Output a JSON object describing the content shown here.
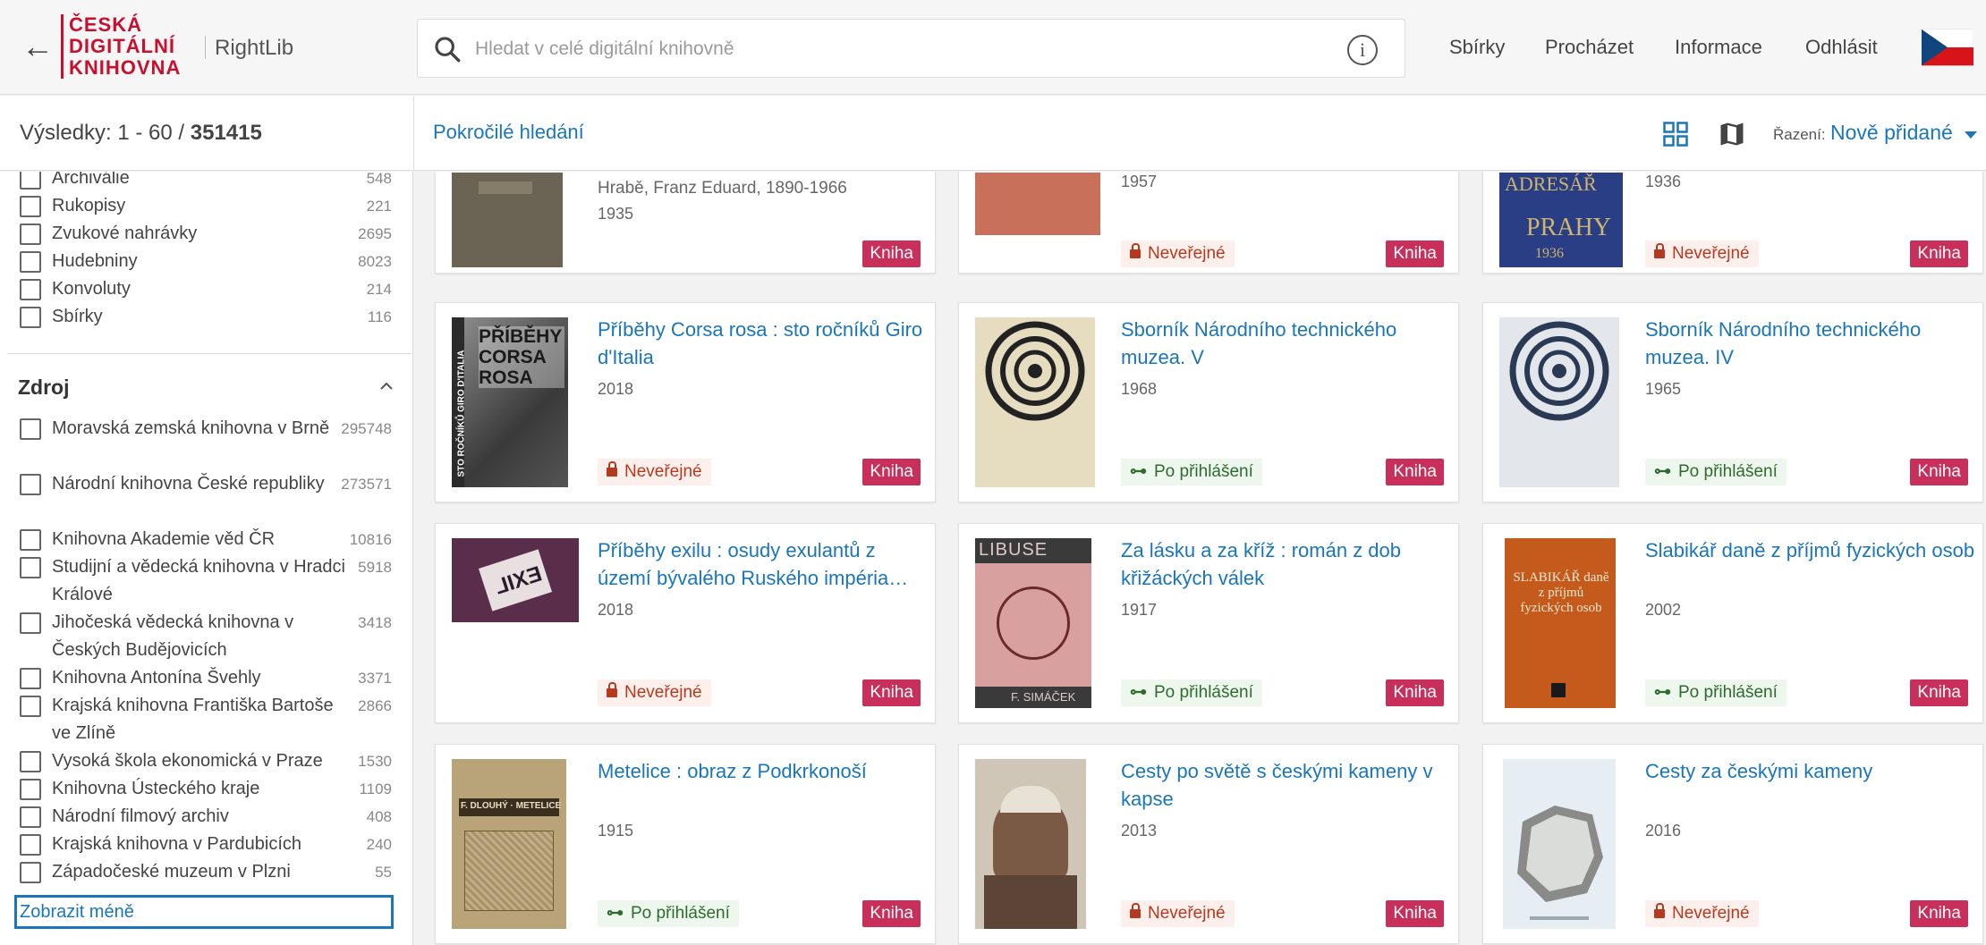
{
  "header": {
    "back_label": "←",
    "logo_line1": "ČESKÁ",
    "logo_line2": "DIGITÁLNÍ",
    "logo_line3": "KNIHOVNA",
    "app_name": "RightLib",
    "search_placeholder": "Hledat v celé digitální knihovně",
    "info_label": "i",
    "nav": [
      "Sbírky",
      "Procházet",
      "Informace",
      "Odhlásit"
    ]
  },
  "results": {
    "prefix": "Výsledky: 1 - 60 / ",
    "total": "351415",
    "advanced_search": "Pokročilé hledání",
    "sort_label": "Řazení:",
    "sort_value": "Nově přidané"
  },
  "sidebar": {
    "type_items": [
      {
        "label": "Archiválie",
        "count": "548"
      },
      {
        "label": "Rukopisy",
        "count": "221"
      },
      {
        "label": "Zvukové nahrávky",
        "count": "2695"
      },
      {
        "label": "Hudebniny",
        "count": "8023"
      },
      {
        "label": "Konvoluty",
        "count": "214"
      },
      {
        "label": "Sbírky",
        "count": "116"
      }
    ],
    "source_title": "Zdroj",
    "source_items": [
      {
        "label": "Moravská zemská knihovna v Brně",
        "count": "295748"
      },
      {
        "label": "Národní knihovna České republiky",
        "count": "273571"
      },
      {
        "label": "Knihovna Akademie věd ČR",
        "count": "10816"
      },
      {
        "label": "Studijní a vědecká knihovna v Hradci Králové",
        "count": "5918"
      },
      {
        "label": "Jihočeská vědecká knihovna v Českých Budějovicích",
        "count": "3418"
      },
      {
        "label": "Knihovna Antonína Švehly",
        "count": "3371"
      },
      {
        "label": "Krajská knihovna Františka Bartoše ve Zlíně",
        "count": "2866"
      },
      {
        "label": "Vysoká škola ekonomická v Praze",
        "count": "1530"
      },
      {
        "label": "Knihovna Ústeckého kraje",
        "count": "1109"
      },
      {
        "label": "Národní filmový archiv",
        "count": "408"
      },
      {
        "label": "Krajská knihovna v Pardubicích",
        "count": "240"
      },
      {
        "label": "Západočeské muzeum v Plzni",
        "count": "55"
      }
    ],
    "show_less": "Zobrazit méně"
  },
  "cards": [
    {
      "title": "Hrabě, Franz Eduard, 1890-1966",
      "year": "1935",
      "access": "",
      "type": "Kniha"
    },
    {
      "title": "",
      "year": "1957",
      "access": "Neveřejné",
      "type": "Kniha"
    },
    {
      "title": "",
      "year": "1936",
      "access": "Neveřejné",
      "type": "Kniha"
    },
    {
      "title": "Příběhy Corsa rosa : sto ročníků Giro d'Italia",
      "year": "2018",
      "access": "Neveřejné",
      "type": "Kniha"
    },
    {
      "title": "Sborník Národního technického muzea. V",
      "year": "1968",
      "access": "Po přihlášení",
      "type": "Kniha"
    },
    {
      "title": "Sborník Národního technického muzea. IV",
      "year": "1965",
      "access": "Po přihlášení",
      "type": "Kniha"
    },
    {
      "title": "Příběhy exilu : osudy exulantů z území bývalého Ruského impéria…",
      "year": "2018",
      "access": "Neveřejné",
      "type": "Kniha"
    },
    {
      "title": "Za lásku a za kříž : román z dob křižáckých válek",
      "year": "1917",
      "access": "Po přihlášení",
      "type": "Kniha"
    },
    {
      "title": "Slabikář daně z příjmů fyzických osob",
      "year": "2002",
      "access": "Po přihlášení",
      "type": "Kniha"
    },
    {
      "title": "Metelice : obraz z Podkrkonoší",
      "year": "1915",
      "access": "Po přihlášení",
      "type": "Kniha"
    },
    {
      "title": "Cesty po světě s českými kameny v kapse",
      "year": "2013",
      "access": "Neveřejné",
      "type": "Kniha"
    },
    {
      "title": "Cesty za českými kameny",
      "year": "2016",
      "access": "Neveřejné",
      "type": "Kniha"
    }
  ],
  "cover_texts": {
    "corsa": "PŘÍBĚHY CORSA ROSA",
    "corsa_side": "STO ROČNÍKŮ GIRO D'ITALIA",
    "exil": "EXIL",
    "libuse": "LIBUSE",
    "libuse_author": "F. SIMÁČEK",
    "slabikar": "SLABIKÁŘ daně z příjmů fyzických osob",
    "metelice": "F. DLOUHÝ · METELICE",
    "adresar": "ADRESÁŘ",
    "praha": "PRAHY",
    "cover_year": "1936"
  }
}
